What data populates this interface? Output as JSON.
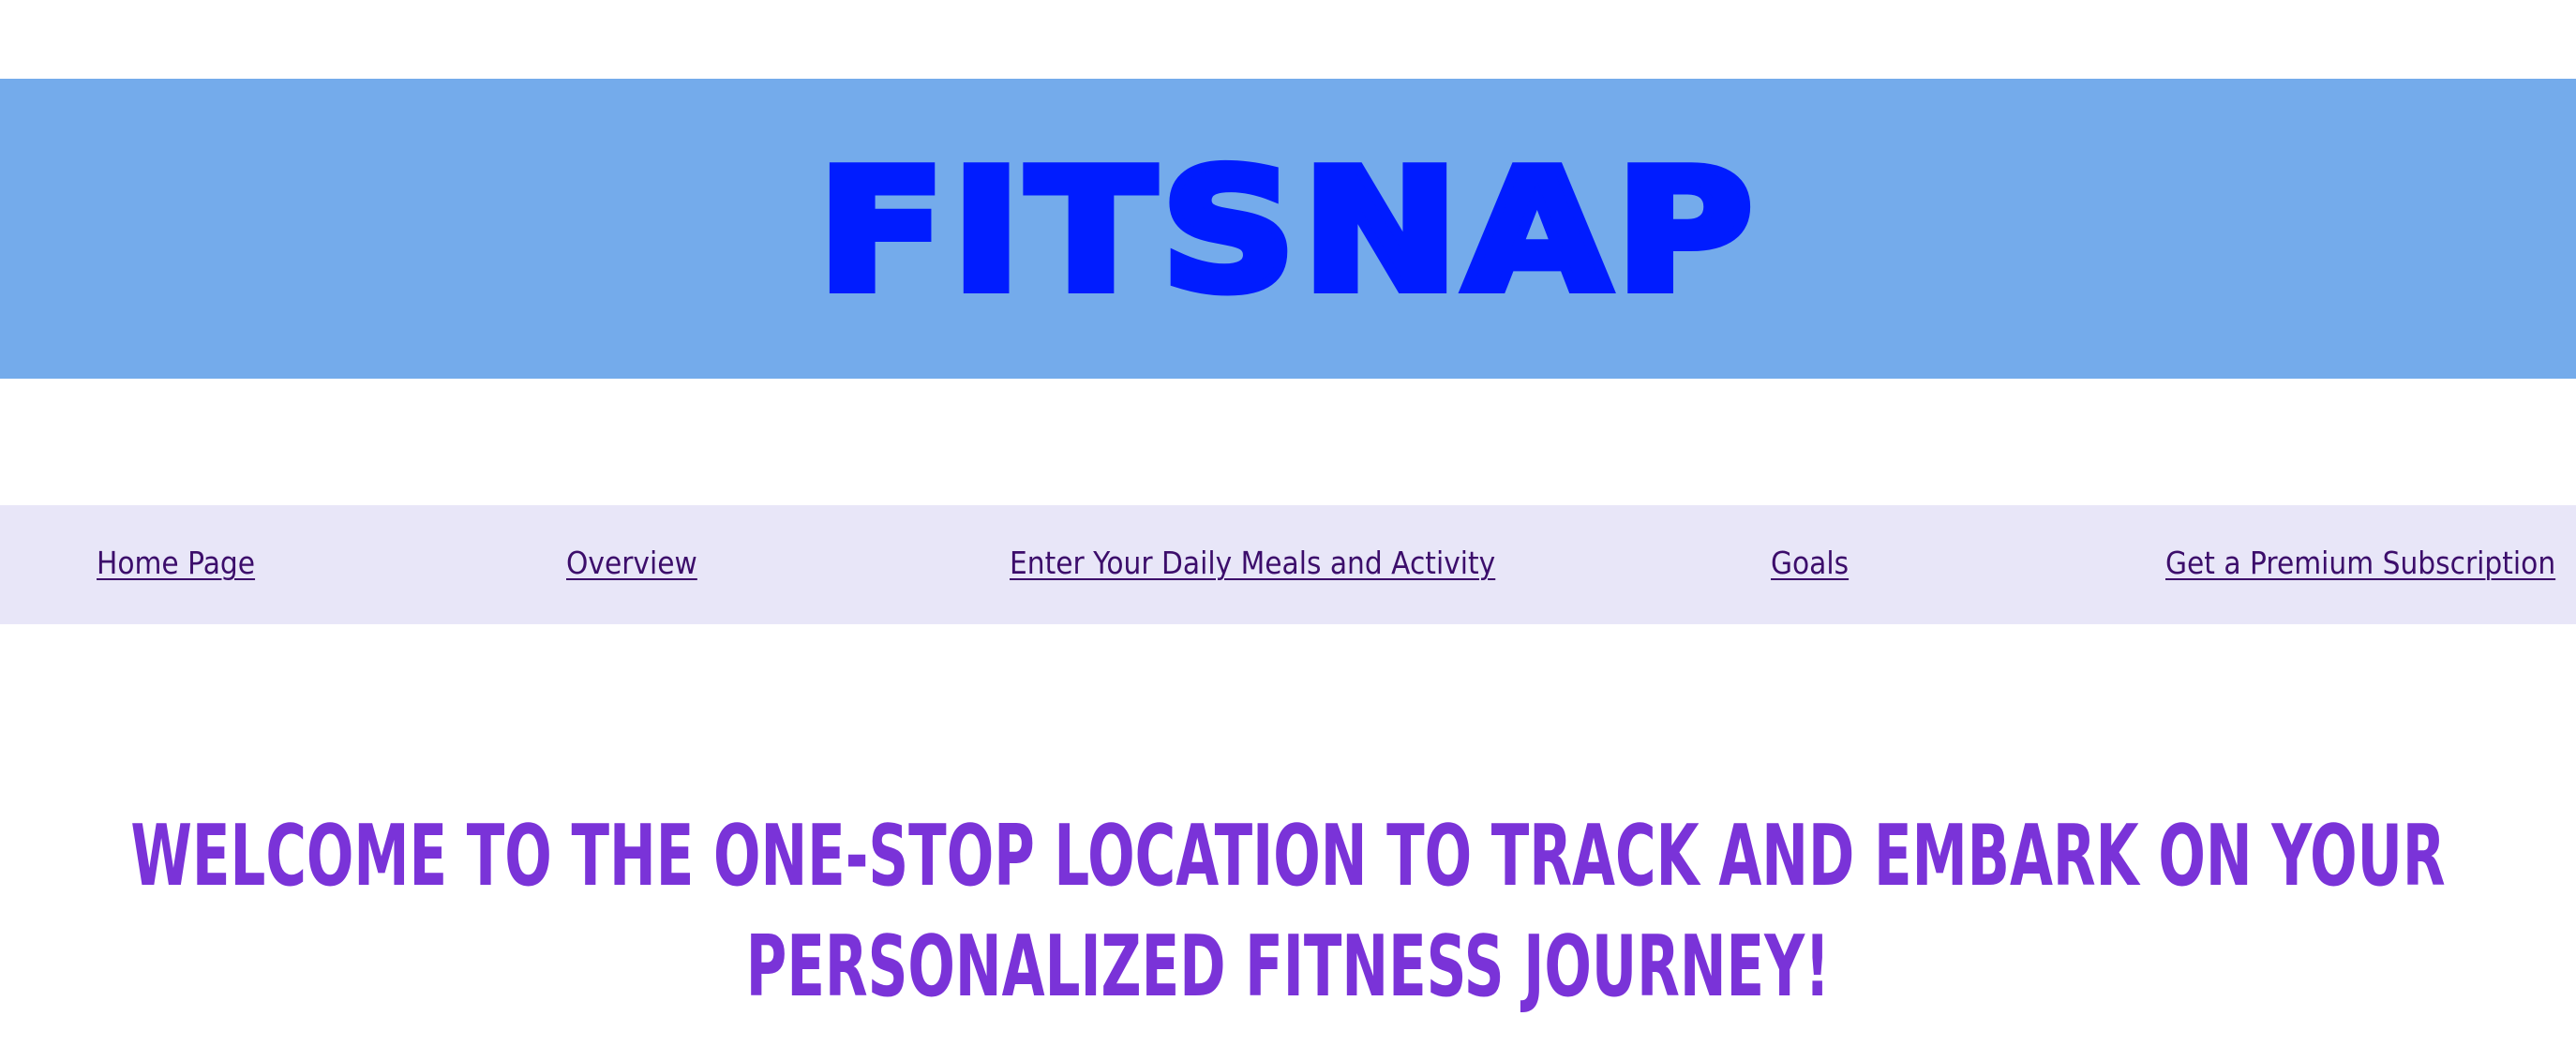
{
  "header": {
    "logo_text": "FITSNAP",
    "banner_color": "#74abeb",
    "logo_color": "#001cff"
  },
  "nav": {
    "background": "#e8e6f8",
    "items": [
      {
        "label": "Home Page"
      },
      {
        "label": "Overview"
      },
      {
        "label": "Enter Your Daily Meals and Activity"
      },
      {
        "label": "Goals"
      },
      {
        "label": "Get a Premium Subscription"
      }
    ]
  },
  "main": {
    "welcome_heading": "WELCOME TO THE ONE-STOP LOCATION TO TRACK AND EMBARK ON YOUR PERSONALIZED FITNESS JOURNEY!",
    "heading_color": "#7a33d8"
  }
}
